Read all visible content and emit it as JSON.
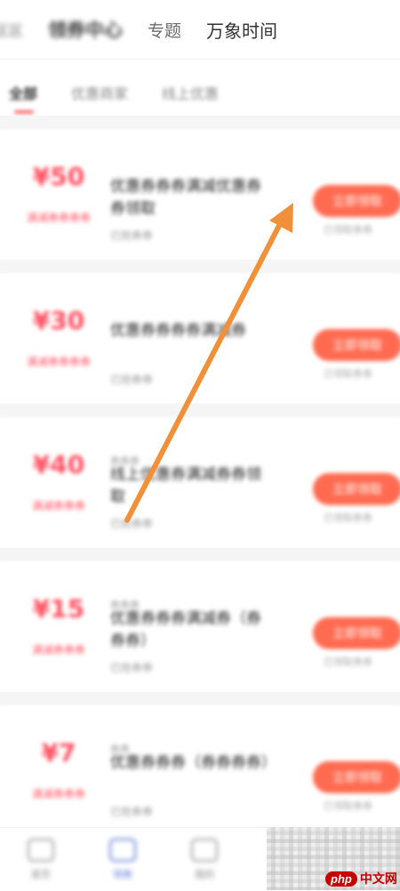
{
  "top_tabs": [
    {
      "label": "区区"
    },
    {
      "label": "领券中心"
    },
    {
      "label": "专题"
    },
    {
      "label": "万象时间"
    }
  ],
  "sub_tabs": [
    {
      "label": "全部"
    },
    {
      "label": "优惠商家"
    },
    {
      "label": "线上优惠"
    }
  ],
  "coupons": [
    {
      "amount": "¥50",
      "condition": "满减券券券券",
      "tag": "",
      "title": "优惠券券券满减优惠券券领取",
      "sub": "已抢券券",
      "button": "立即领取",
      "note": "已领取券券"
    },
    {
      "amount": "¥30",
      "condition": "满减券券券券",
      "tag": "",
      "title": "优惠券券券券满减券",
      "sub": "已抢券券",
      "button": "立即领取",
      "note": "已领取券券"
    },
    {
      "amount": "¥40",
      "condition": "满减券券券",
      "tag": "券券券",
      "title": "线上优惠券满减券券领取",
      "sub": "已抢券券",
      "button": "立即领取",
      "note": "已领取券券"
    },
    {
      "amount": "¥15",
      "condition": "满减券券券",
      "tag": "券券券",
      "title": "优惠券券券满减券（券券券）",
      "sub": "已抢券券",
      "button": "立即领取",
      "note": "已领取券券"
    },
    {
      "amount": "¥7",
      "condition": "满减券券券",
      "tag": "券券",
      "title": "优惠券券券（券券券券）",
      "sub": "已抢券券",
      "button": "立即领取",
      "note": "已领取券券"
    }
  ],
  "bottom_nav": [
    {
      "label": "首页",
      "icon": "home-icon"
    },
    {
      "label": "领券",
      "icon": "coupon-icon"
    },
    {
      "label": "我的",
      "icon": "user-icon"
    }
  ],
  "watermark": {
    "logo": "php",
    "text": "中文网"
  },
  "colors": {
    "accent": "#ff6b50",
    "price": "#ff4d5e",
    "arrow": "#f0913a",
    "active_nav": "#5b7bd5"
  }
}
